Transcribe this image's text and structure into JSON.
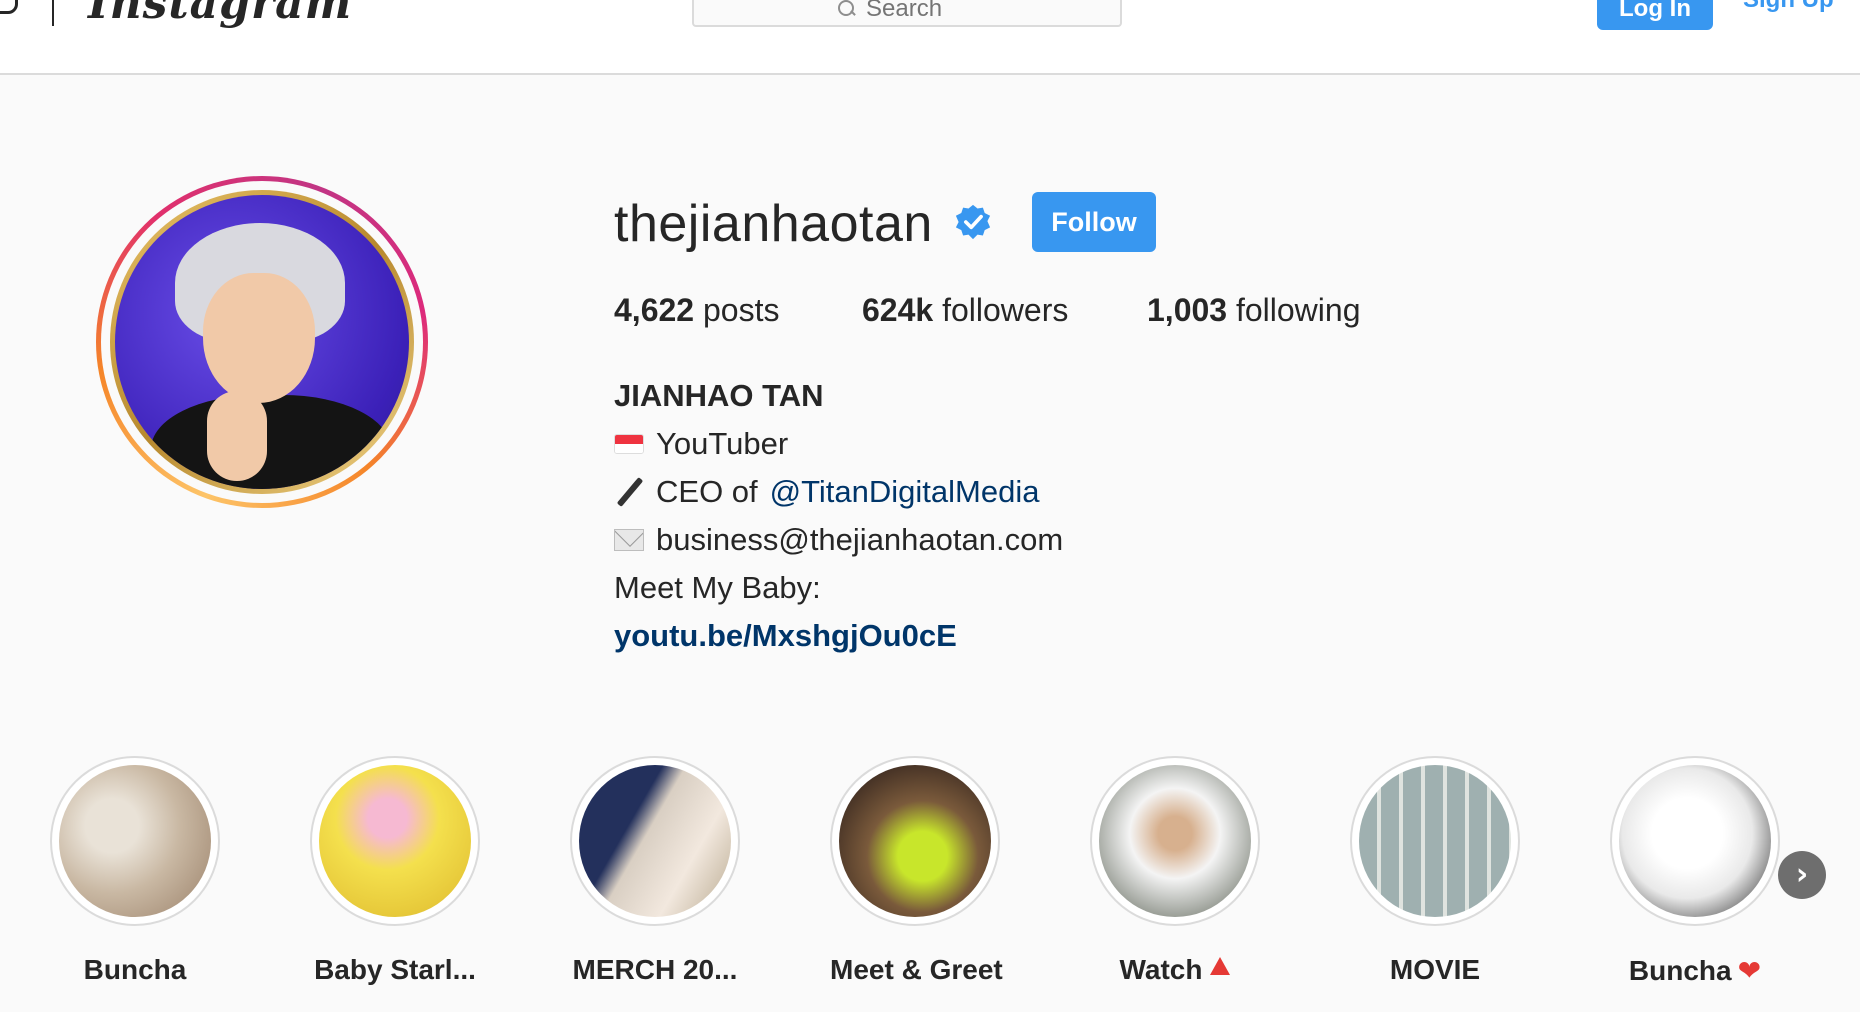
{
  "nav": {
    "logo_text": "Instagram",
    "search_placeholder": "Search",
    "login_label": "Log In",
    "signup_label": "Sign Up"
  },
  "profile": {
    "username": "thejianhaotan",
    "verified": true,
    "follow_label": "Follow",
    "stats": {
      "posts_count": "4,622",
      "posts_label": "posts",
      "followers_count": "624k",
      "followers_label": "followers",
      "following_count": "1,003",
      "following_label": "following"
    },
    "bio": {
      "name": "JIANHAO TAN",
      "line1_icon": "singapore-flag-icon",
      "line1_text": "YouTuber",
      "line2_icon": "pen-icon",
      "line2_prefix": "CEO of",
      "line2_mention": "@TitanDigitalMedia",
      "line3_icon": "envelope-icon",
      "line3_text": "business@thejianhaotan.com",
      "line4_text": "Meet My Baby:",
      "link": "youtu.be/MxshgjOu0cE"
    }
  },
  "highlights": [
    {
      "label": "Buncha",
      "suffix_icon": ""
    },
    {
      "label": "Baby Starl...",
      "suffix_icon": ""
    },
    {
      "label": "MERCH 20...",
      "suffix_icon": ""
    },
    {
      "label": "Meet & Greet",
      "suffix_icon": ""
    },
    {
      "label": "Watch",
      "suffix_icon": "red-triangle-icon"
    },
    {
      "label": "MOVIE",
      "suffix_icon": ""
    },
    {
      "label": "Buncha",
      "suffix_icon": "red-heart-icon"
    }
  ],
  "highlights_next_symbol": "›",
  "colors": {
    "accent_blue": "#3897f0",
    "link_blue": "#003569",
    "text": "#262626",
    "page_bg": "#fafafa"
  }
}
